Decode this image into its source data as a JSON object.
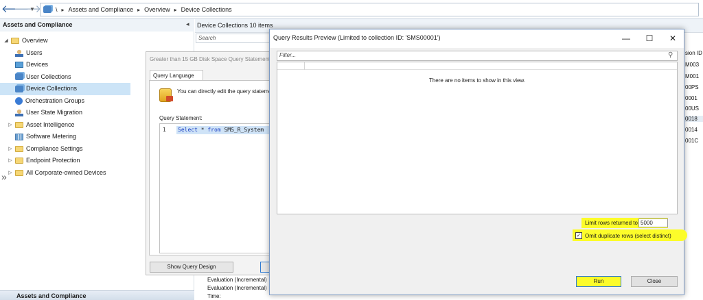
{
  "breadcrumb": {
    "root": "\\",
    "items": [
      "Assets and Compliance",
      "Overview",
      "Device Collections"
    ]
  },
  "nav": {
    "header": "Assets and Compliance",
    "items": [
      {
        "label": "Overview",
        "level": 0,
        "icon": "folder-icon"
      },
      {
        "label": "Users",
        "level": 1,
        "icon": "user-icon"
      },
      {
        "label": "Devices",
        "level": 1,
        "icon": "devices-icon"
      },
      {
        "label": "User Collections",
        "level": 1,
        "icon": "collection-icon"
      },
      {
        "label": "Device Collections",
        "level": 1,
        "icon": "collection-icon",
        "selected": true
      },
      {
        "label": "Orchestration Groups",
        "level": 1,
        "icon": "orchestration-icon"
      },
      {
        "label": "User State Migration",
        "level": 1,
        "icon": "migration-icon"
      },
      {
        "label": "Asset Intelligence",
        "level": 1,
        "icon": "folder-icon",
        "expandable": true
      },
      {
        "label": "Software Metering",
        "level": 1,
        "icon": "metering-icon"
      },
      {
        "label": "Compliance Settings",
        "level": 1,
        "icon": "folder-icon",
        "expandable": true
      },
      {
        "label": "Endpoint Protection",
        "level": 1,
        "icon": "folder-icon",
        "expandable": true
      },
      {
        "label": "All Corporate-owned Devices",
        "level": 1,
        "icon": "folder-icon",
        "expandable": true
      }
    ],
    "bottom_label": "Assets and Compliance"
  },
  "content": {
    "header": "Device Collections 10 items",
    "search_placeholder": "Search",
    "background_ids": [
      "sion ID",
      "M003",
      "M001",
      "00PS",
      "0001",
      "00US",
      "0018",
      "0014",
      "001C"
    ],
    "evaluation_lines": [
      "Evaluation (Incremental)",
      "Evaluation (Incremental)",
      "Time:"
    ]
  },
  "query_statement": {
    "title": "Greater than 15 GB Disk Space Query Statement",
    "tab": "Query Language",
    "description": "You can directly edit the query statement",
    "label": "Query Statement:",
    "line_number": "1",
    "code_kw1": "Select",
    "code_mid": " * ",
    "code_kw2": "from",
    "code_rest": " SMS_R_System",
    "show_design_button": "Show Query Design"
  },
  "dialog": {
    "title": "Query Results Preview (Limited to collection ID: 'SMS00001')",
    "filter_placeholder": "Filter...",
    "empty_message": "There are no items to show in this view.",
    "limit_label": "Limit rows returned to",
    "limit_value": "5000",
    "omit_label": "Omit duplicate rows (select distinct)",
    "omit_checked": true,
    "run_button": "Run",
    "close_button": "Close",
    "highlight_color": "#fcfc2a"
  }
}
